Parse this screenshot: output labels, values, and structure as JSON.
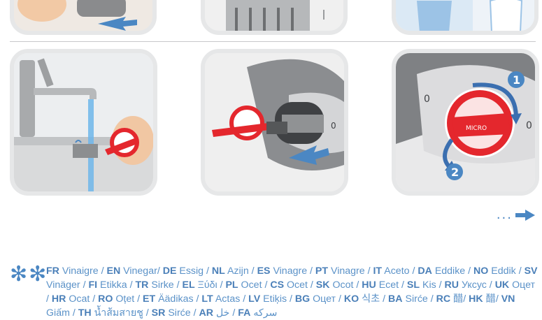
{
  "more_indicator": "...",
  "note_symbol": "✻✻",
  "vinegar_translations": [
    {
      "code": "FR",
      "word": "Vinaigre",
      "sep": " / "
    },
    {
      "code": "EN",
      "word": "Vinegar",
      "sep": "/ "
    },
    {
      "code": "DE",
      "word": "Essig",
      "sep": " / "
    },
    {
      "code": "NL",
      "word": "Azijn",
      "sep": " / "
    },
    {
      "code": "ES",
      "word": "Vinagre",
      "sep": " / "
    },
    {
      "code": "PT",
      "word": "Vinagre",
      "sep": " / "
    },
    {
      "code": "IT",
      "word": "Aceto",
      "sep": " / "
    },
    {
      "code": "DA",
      "word": "Eddike",
      "sep": " / "
    },
    {
      "code": "NO",
      "word": "Eddik",
      "sep": " / "
    },
    {
      "code": "SV",
      "word": "Vinäger",
      "sep": " / "
    },
    {
      "code": "FI",
      "word": "Etikka",
      "sep": " / "
    },
    {
      "code": "TR",
      "word": "Sirke",
      "sep": " / "
    },
    {
      "code": "EL",
      "word": "Ξύδι",
      "sep": " / "
    },
    {
      "code": "PL",
      "word": "Ocet",
      "sep": " / "
    },
    {
      "code": "CS",
      "word": "Ocet",
      "sep": " / "
    },
    {
      "code": "SK",
      "word": "Ocot",
      "sep": " / "
    },
    {
      "code": "HU",
      "word": "Ecet",
      "sep": " / "
    },
    {
      "code": "SL",
      "word": "Kis",
      "sep": " / "
    },
    {
      "code": "RU",
      "word": "Уксус",
      "sep": " / "
    },
    {
      "code": "UK",
      "word": "Оцет",
      "sep": " / "
    },
    {
      "code": "HR",
      "word": "Ocat",
      "sep": " / "
    },
    {
      "code": "RO",
      "word": "Oțet",
      "sep": " / "
    },
    {
      "code": "ET",
      "word": "Äädikas",
      "sep": " / "
    },
    {
      "code": "LT",
      "word": "Actas",
      "sep": " / "
    },
    {
      "code": "LV",
      "word": "Etiķis",
      "sep": " / "
    },
    {
      "code": "BG",
      "word": "Оцет",
      "sep": " / "
    },
    {
      "code": "KO",
      "word": "식초",
      "sep": " / "
    },
    {
      "code": "BA",
      "word": "Sirće",
      "sep": " / "
    },
    {
      "code": "RC",
      "word": "醋",
      "sep": "/ "
    },
    {
      "code": "HK",
      "word": "醋",
      "sep": "/ "
    },
    {
      "code": "VN",
      "word": "Giấm",
      "sep": " / "
    },
    {
      "code": "TH",
      "word": "น้ำส้มสายชู",
      "sep": " / "
    },
    {
      "code": "SR",
      "word": "Sirće",
      "sep": " / "
    },
    {
      "code": "AR",
      "word": "خل",
      "sep": " / "
    },
    {
      "code": "FA",
      "word": "سرکه",
      "sep": ""
    }
  ],
  "step_labels": {
    "rotate_one": "1",
    "rotate_two": "2",
    "filter_brand": "MICRO"
  },
  "colors": {
    "accent_blue": "#4b87c3",
    "red": "#e4272d",
    "panel_border": "#e6e7e8"
  }
}
